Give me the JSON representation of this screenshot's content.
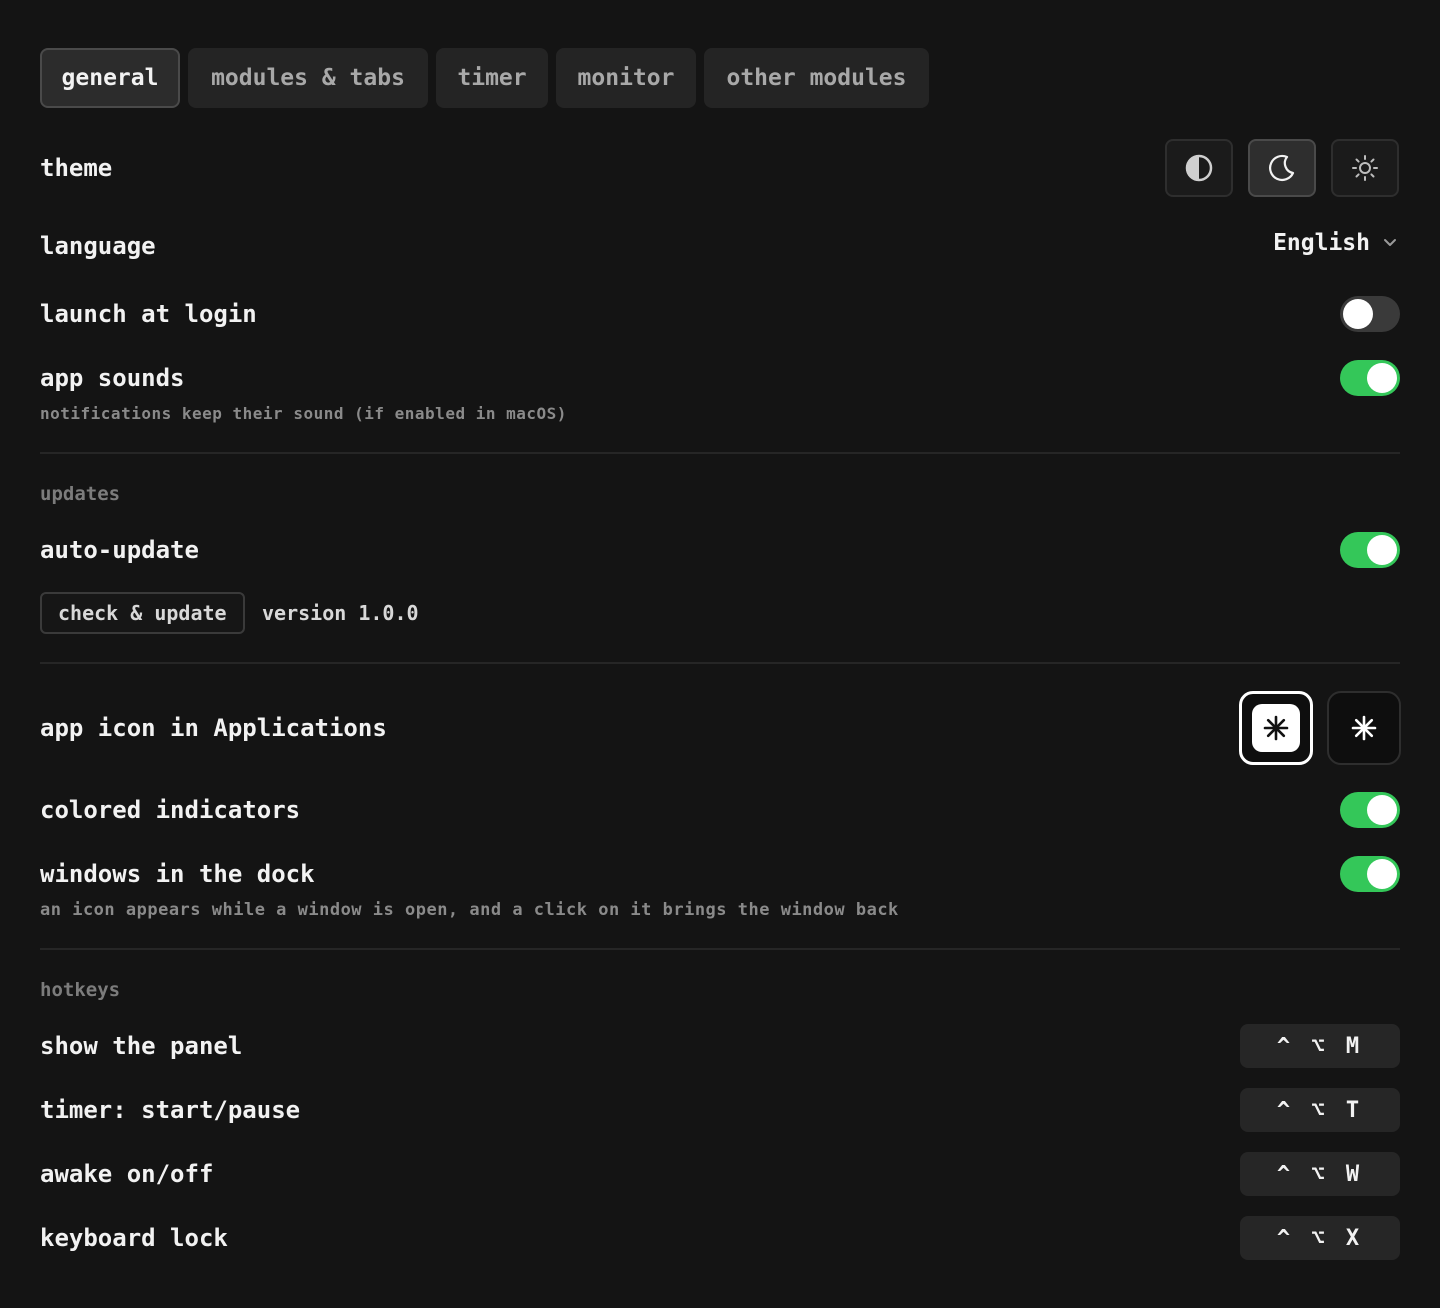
{
  "tabs": [
    {
      "label": "general",
      "active": true
    },
    {
      "label": "modules & tabs",
      "active": false
    },
    {
      "label": "timer",
      "active": false
    },
    {
      "label": "monitor",
      "active": false
    },
    {
      "label": "other modules",
      "active": false
    }
  ],
  "theme": {
    "label": "theme",
    "options": [
      {
        "icon": "half-circle-icon",
        "active": false
      },
      {
        "icon": "moon-icon",
        "active": true
      },
      {
        "icon": "sun-icon",
        "active": false
      }
    ]
  },
  "language": {
    "label": "language",
    "value": "English"
  },
  "launch_at_login": {
    "label": "launch at login",
    "on": false
  },
  "app_sounds": {
    "label": "app sounds",
    "note": "notifications keep their sound (if enabled in macOS)",
    "on": true
  },
  "updates": {
    "section": "updates",
    "auto_update": {
      "label": "auto-update",
      "on": true
    },
    "check_button": "check & update",
    "version": "version 1.0.0"
  },
  "app_icon": {
    "label": "app icon in Applications",
    "options": [
      "light-asterisk-icon",
      "dark-asterisk-icon"
    ],
    "selected": 0
  },
  "colored_indicators": {
    "label": "colored indicators",
    "on": true
  },
  "windows_in_dock": {
    "label": "windows in the dock",
    "note": "an icon appears while a window is open, and a click on it brings the window back",
    "on": true
  },
  "hotkeys": {
    "section": "hotkeys",
    "items": [
      {
        "label": "show the panel",
        "keys": "^ ⌥ M"
      },
      {
        "label": "timer: start/pause",
        "keys": "^ ⌥ T"
      },
      {
        "label": "awake on/off",
        "keys": "^ ⌥ W"
      },
      {
        "label": "keyboard lock",
        "keys": "^ ⌥ X"
      }
    ]
  },
  "colors": {
    "background": "#141414",
    "toggle_on": "#34c759",
    "toggle_off": "#3a3a3a"
  }
}
